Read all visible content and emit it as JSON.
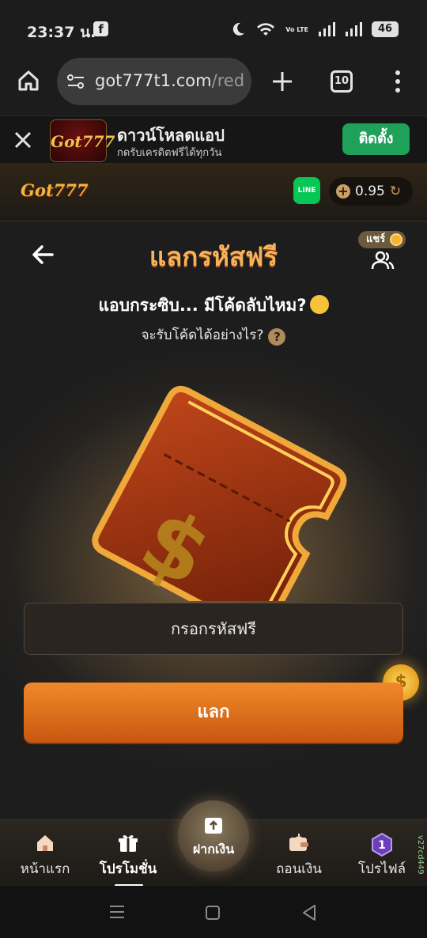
{
  "status_bar": {
    "time": "23:37 น.",
    "notification_icon": "facebook-icon",
    "network_label": "Vo LTE",
    "battery": "46"
  },
  "browser": {
    "url_main": "got777t1.com",
    "url_rest": "/red",
    "tab_count": "10"
  },
  "install_banner": {
    "app_name": "ดาวน์โหลดแอป",
    "subtitle": "กดรับเครดิตฟรีได้ทุกวัน",
    "install_label": "ติดตั้ง",
    "app_icon_text": "Got777"
  },
  "site_header": {
    "logo_text": "Got777",
    "line_label": "LINE",
    "balance": "0.95"
  },
  "page": {
    "title": "แลกรหัสฟรี",
    "share_label": "แชร์",
    "headline": "แอบกระซิบ... มีโค้ดลับไหม?",
    "subline": "จะรับโค้ดได้อย่างไร?",
    "input_placeholder": "กรอกรหัสฟรี",
    "redeem_label": "แลก"
  },
  "bottom_nav": {
    "items": [
      {
        "label": "หน้าแรก",
        "icon": "home-icon"
      },
      {
        "label": "โปรโมชั่น",
        "icon": "gift-icon"
      },
      {
        "label": "ฝากเงิน",
        "icon": "deposit-icon"
      },
      {
        "label": "ถอนเงิน",
        "icon": "wallet-icon"
      },
      {
        "label": "โปรไฟล์",
        "icon": "level-badge-icon"
      }
    ],
    "active_index": 1,
    "level": "1",
    "build_tag": "v27cd449"
  },
  "colors": {
    "accent_orange": "#e07a22",
    "title_gold": "#f7b25a",
    "install_green": "#1fa15a",
    "line_green": "#06c755"
  }
}
